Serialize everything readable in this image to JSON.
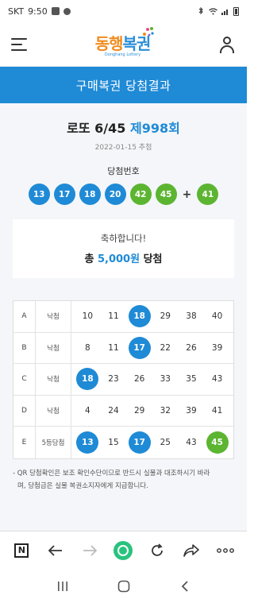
{
  "status_bar": {
    "carrier": "SKT",
    "time": "9:50"
  },
  "header": {
    "logo_main_1": "동행",
    "logo_main_2": "복권",
    "logo_sub": "Donghang Lottery"
  },
  "banner": {
    "title": "구매복권 당첨결과"
  },
  "draw": {
    "game": "로또 6/45",
    "round": "제998회",
    "date": "2022-01-15 추첨",
    "winning_label": "당첨번호",
    "numbers": [
      {
        "n": "13",
        "color": "blue"
      },
      {
        "n": "17",
        "color": "blue"
      },
      {
        "n": "18",
        "color": "blue"
      },
      {
        "n": "20",
        "color": "blue"
      },
      {
        "n": "42",
        "color": "green"
      },
      {
        "n": "45",
        "color": "green"
      }
    ],
    "plus": "+",
    "bonus": "41"
  },
  "result": {
    "congrats": "축하합니다!",
    "prize_prefix": "총",
    "prize_amount": "5,000원",
    "prize_suffix": "당첨"
  },
  "ticket": [
    {
      "letter": "A",
      "result": "낙첨",
      "nums": [
        {
          "n": "10",
          "h": ""
        },
        {
          "n": "11",
          "h": ""
        },
        {
          "n": "18",
          "h": "blue"
        },
        {
          "n": "29",
          "h": ""
        },
        {
          "n": "38",
          "h": ""
        },
        {
          "n": "40",
          "h": ""
        }
      ]
    },
    {
      "letter": "B",
      "result": "낙첨",
      "nums": [
        {
          "n": "8",
          "h": ""
        },
        {
          "n": "11",
          "h": ""
        },
        {
          "n": "17",
          "h": "blue"
        },
        {
          "n": "22",
          "h": ""
        },
        {
          "n": "26",
          "h": ""
        },
        {
          "n": "39",
          "h": ""
        }
      ]
    },
    {
      "letter": "C",
      "result": "낙첨",
      "nums": [
        {
          "n": "18",
          "h": "blue"
        },
        {
          "n": "23",
          "h": ""
        },
        {
          "n": "26",
          "h": ""
        },
        {
          "n": "33",
          "h": ""
        },
        {
          "n": "35",
          "h": ""
        },
        {
          "n": "43",
          "h": ""
        }
      ]
    },
    {
      "letter": "D",
      "result": "낙첨",
      "nums": [
        {
          "n": "4",
          "h": ""
        },
        {
          "n": "24",
          "h": ""
        },
        {
          "n": "29",
          "h": ""
        },
        {
          "n": "32",
          "h": ""
        },
        {
          "n": "39",
          "h": ""
        },
        {
          "n": "41",
          "h": ""
        }
      ]
    },
    {
      "letter": "E",
      "result": "5등당첨",
      "nums": [
        {
          "n": "13",
          "h": "blue"
        },
        {
          "n": "15",
          "h": ""
        },
        {
          "n": "17",
          "h": "blue"
        },
        {
          "n": "25",
          "h": ""
        },
        {
          "n": "43",
          "h": ""
        },
        {
          "n": "45",
          "h": "green"
        }
      ]
    }
  ],
  "notice": {
    "line1": "- QR 당첨확인은 보조 확인수단이므로 반드시 실물과 대조하시기 바라",
    "line2": "며, 당첨금은 실물 복권소지자에게 지급합니다."
  },
  "browser_toolbar": {
    "icons": [
      "n-icon",
      "back-arrow-icon",
      "forward-arrow-icon",
      "home-icon",
      "refresh-icon",
      "share-icon",
      "more-icon"
    ]
  },
  "colors": {
    "accent": "#1f8ad6",
    "green_ball": "#5cb531",
    "home": "#28c37e"
  }
}
